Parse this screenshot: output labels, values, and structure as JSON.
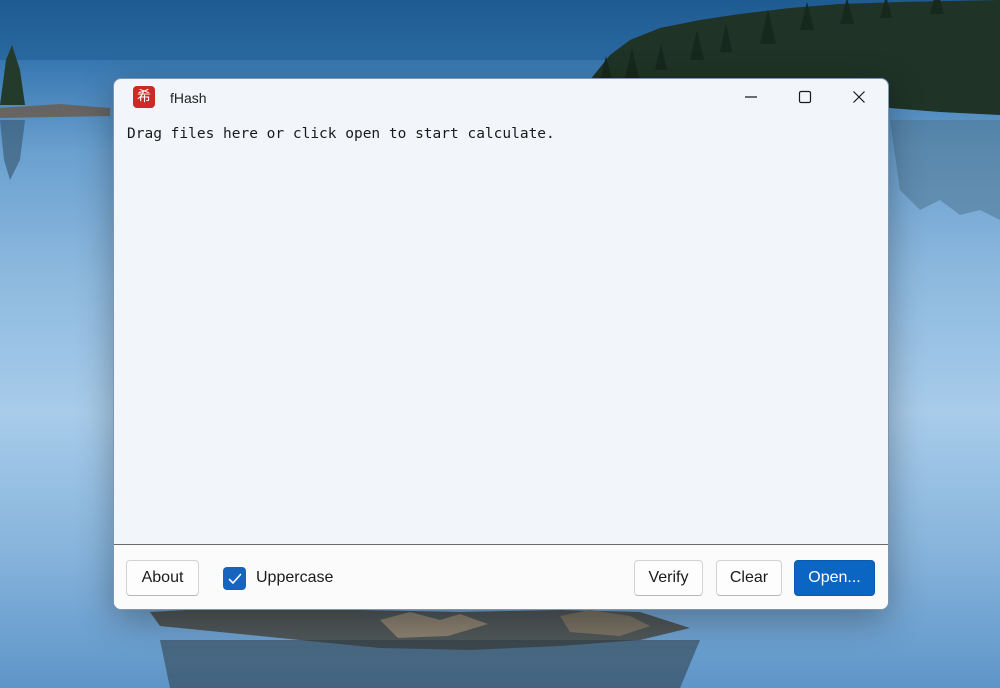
{
  "window": {
    "title": "fHash",
    "app_icon_glyph": "希",
    "app_icon_color": "#cc2a24"
  },
  "caption_buttons": {
    "minimize": "minimize-icon",
    "maximize": "maximize-icon",
    "close": "close-icon"
  },
  "content": {
    "hint": "Drag files here or click open to start calculate."
  },
  "footer": {
    "about_label": "About",
    "uppercase_label": "Uppercase",
    "uppercase_checked": true,
    "verify_label": "Verify",
    "clear_label": "Clear",
    "open_label": "Open..."
  },
  "colors": {
    "accent": "#0b65c2",
    "checkbox": "#1565c0",
    "window_bg": "#f2f5f9"
  }
}
